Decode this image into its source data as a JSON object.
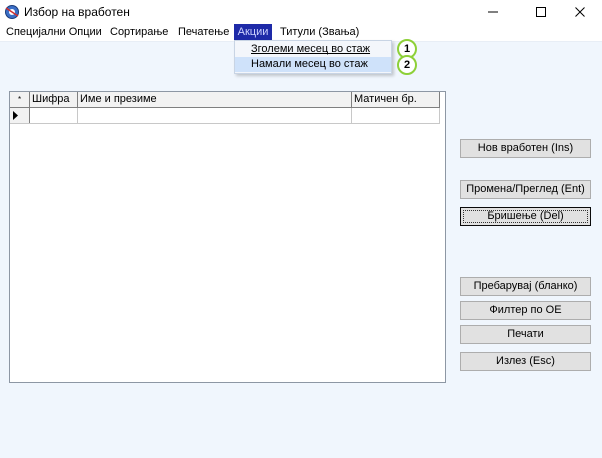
{
  "window": {
    "title": "Избор на вработен",
    "icon": "app-icon",
    "controls": [
      "minimize-icon",
      "maximize-icon",
      "close-icon"
    ]
  },
  "menu": {
    "items": [
      {
        "label": "Специјални Опции"
      },
      {
        "label": "Сортирање"
      },
      {
        "label": "Печатење"
      },
      {
        "label": "Акции"
      },
      {
        "label": "Титули (Звања)"
      }
    ],
    "active_index": 3
  },
  "dropdown": {
    "items": [
      {
        "label": "Зголеми месец во стаж",
        "callout": "1"
      },
      {
        "label": "Намали месец во стаж",
        "callout": "2"
      }
    ]
  },
  "grid": {
    "columns": [
      {
        "label": "*"
      },
      {
        "label": "Шифра"
      },
      {
        "label": "Име и презиме"
      },
      {
        "label": "Матичен бр."
      }
    ],
    "rows": [
      {
        "sifra": "",
        "ime": "",
        "maticen": ""
      }
    ]
  },
  "buttons": {
    "new": "Нов вработен (Ins)",
    "edit": "Промена/Преглед (Ent)",
    "delete": "Бришење (Del)",
    "search": "Пребарувај (бланко)",
    "filter": "Филтер по ОЕ",
    "print": "Печати",
    "exit": "Излез (Esc)"
  },
  "colors": {
    "background": "#f0f6fd",
    "menu_active": "#1e2aa8",
    "highlight": "#cfe2fa",
    "callout_ring": "#8dd038"
  }
}
